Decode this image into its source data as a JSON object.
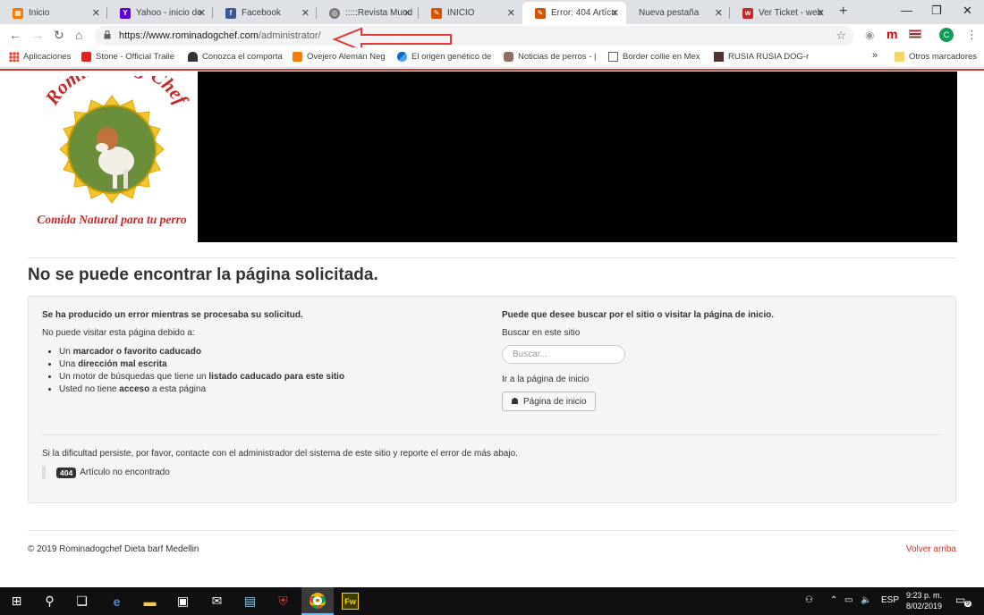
{
  "browser": {
    "tabs": [
      {
        "label": "Inicio",
        "icon": "orange-grid-icon",
        "active": false
      },
      {
        "label": "Yahoo - inicio de",
        "icon": "yahoo-icon",
        "active": false
      },
      {
        "label": "Facebook",
        "icon": "facebook-icon",
        "active": false
      },
      {
        "label": ":::::Revista Mund",
        "icon": "globe-icon",
        "active": false
      },
      {
        "label": "INICIO",
        "icon": "dog-chef-icon",
        "active": false
      },
      {
        "label": "Error: 404 Artícu",
        "icon": "dog-chef-icon",
        "active": true
      },
      {
        "label": "Nueva pestaña",
        "icon": "",
        "active": false
      },
      {
        "label": "Ver Ticket - web",
        "icon": "webhost-icon",
        "active": false
      }
    ],
    "tab_close_glyph": "✕",
    "new_tab_glyph": "+",
    "window_controls": {
      "minimize": "—",
      "restore": "❐",
      "close": "✕"
    },
    "nav": {
      "back": "←",
      "forward": "→",
      "reload": "↻",
      "home": "⌂"
    },
    "url": {
      "host": "https://www.rominadogchef.com",
      "path": "/administrator/"
    },
    "bookmarks": [
      {
        "label": "Aplicaciones",
        "icon": "apps-grid-icon"
      },
      {
        "label": "Stone - Official Traile",
        "icon": "youtube-icon"
      },
      {
        "label": "Conozca el comporta",
        "icon": "dog-silhouette-icon"
      },
      {
        "label": "Ovejero Alemán Neg",
        "icon": "blogger-icon"
      },
      {
        "label": "El origen genético de",
        "icon": "blue-s-icon"
      },
      {
        "label": "Noticias de perros - |",
        "icon": "dog-news-icon"
      },
      {
        "label": "Border collie en Mex",
        "icon": "page-icon"
      },
      {
        "label": "RUSIA RUSIA DOG-ra",
        "icon": "dog-photo-icon"
      }
    ],
    "bookmarks_overflow": "»",
    "other_bookmarks": "Otros marcadores",
    "profile_initial": "C",
    "ext_m": "m",
    "colors": {
      "tab_bg": "#dee1e6",
      "omnibox_bg": "#f1f3f4",
      "accent_red": "#c0392b"
    }
  },
  "site": {
    "logo": {
      "title": "Romina Dog Chef",
      "tagline": "Comida Natural para tu perro"
    },
    "page_title": "No se puede encontrar la página solicitada.",
    "left": {
      "heading": "Se ha producido un error mientras se procesaba su solicitud.",
      "intro": "No puede visitar esta página debido a:",
      "reasons": [
        {
          "pre": "Un ",
          "bold": "marcador o favorito caducado",
          "post": ""
        },
        {
          "pre": "Una ",
          "bold": "dirección mal escrita",
          "post": ""
        },
        {
          "pre": "Un motor de búsquedas que tiene un ",
          "bold": "listado caducado para este sitio",
          "post": ""
        },
        {
          "pre": "Usted no tiene ",
          "bold": "acceso",
          "post": " a esta página"
        }
      ]
    },
    "right": {
      "heading": "Puede que desee buscar por el sitio o visitar la página de inicio.",
      "search_label": "Buscar en este sitio",
      "search_placeholder": "Buscar...",
      "home_label": "Ir a la página de inicio",
      "home_button": "Página de inicio"
    },
    "persist_text": "Si la dificultad persiste, por favor, contacte con el administrador del sistema de este sitio y reporte el error de más abajo.",
    "error_code": "404",
    "error_message": "Artículo no encontrado",
    "copyright": "© 2019 Rominadogchef Dieta barf Medellin",
    "back_to_top": "Volver arriba"
  },
  "taskbar": {
    "language": "ESP",
    "time": "9:23 p. m.",
    "date": "8/02/2019",
    "notifications": "9"
  }
}
